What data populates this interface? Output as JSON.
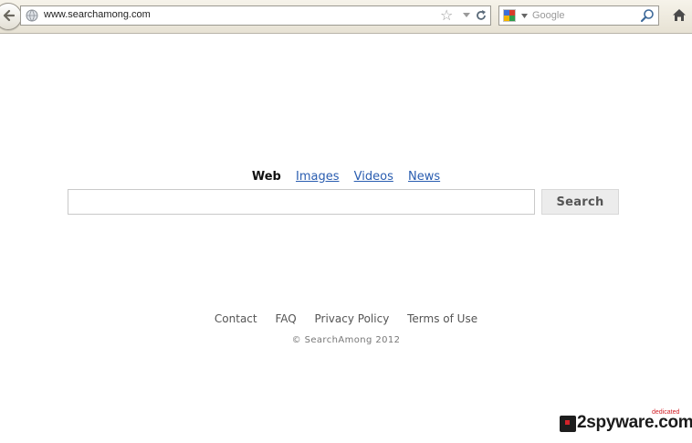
{
  "browser": {
    "url": "www.searchamong.com",
    "search_placeholder": "Google"
  },
  "tabs": [
    {
      "label": "Web",
      "active": true
    },
    {
      "label": "Images",
      "active": false
    },
    {
      "label": "Videos",
      "active": false
    },
    {
      "label": "News",
      "active": false
    }
  ],
  "search": {
    "query": "",
    "button_label": "Search"
  },
  "footer": {
    "links": [
      "Contact",
      "FAQ",
      "Privacy Policy",
      "Terms of Use"
    ],
    "copyright": "© SearchAmong 2012"
  },
  "watermark": {
    "text": "2spyware.com",
    "tagline": "dedicated"
  },
  "colors": {
    "link": "#2a5db0",
    "button_bg": "#ececec",
    "watermark_accent": "#d2232a"
  }
}
